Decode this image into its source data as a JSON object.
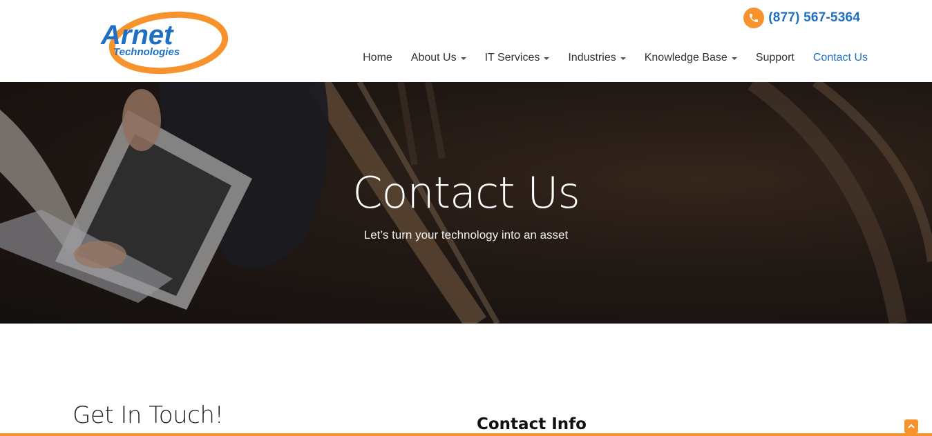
{
  "brand": {
    "name_line1": "Arnet",
    "name_line2": "Technologies",
    "accent_color": "#f7922d",
    "primary_color": "#1f6fc5"
  },
  "header": {
    "phone": "(877) 567-5364",
    "phone_icon": "phone-icon"
  },
  "nav": {
    "items": [
      {
        "label": "Home",
        "has_dropdown": false,
        "active": false
      },
      {
        "label": "About Us",
        "has_dropdown": true,
        "active": false
      },
      {
        "label": "IT Services",
        "has_dropdown": true,
        "active": false
      },
      {
        "label": "Industries",
        "has_dropdown": true,
        "active": false
      },
      {
        "label": "Knowledge Base",
        "has_dropdown": true,
        "active": false
      },
      {
        "label": "Support",
        "has_dropdown": false,
        "active": false
      },
      {
        "label": "Contact Us",
        "has_dropdown": false,
        "active": true
      }
    ]
  },
  "hero": {
    "title": "Contact Us",
    "subtitle": "Let’s turn your technology into an asset"
  },
  "main": {
    "get_in_touch": "Get In Touch!",
    "contact_info": "Contact Info"
  },
  "scroll_top_icon": "chevron-up-icon"
}
